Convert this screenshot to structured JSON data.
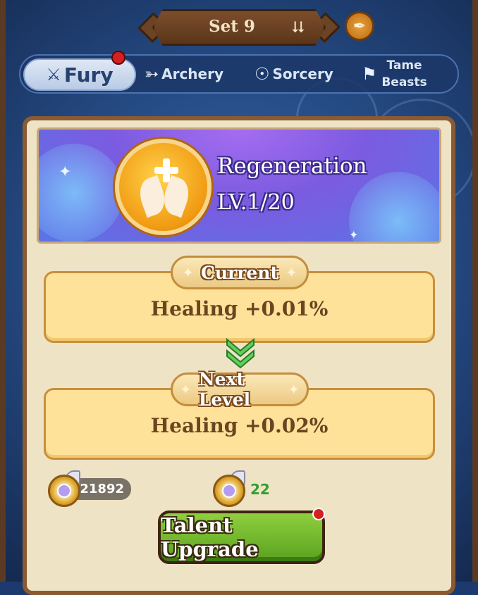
{
  "set_selector": {
    "label": "Set 9",
    "icon": "chevron-down-icon"
  },
  "feather_button": {
    "icon": "feather-icon"
  },
  "tabs": [
    {
      "label": "Fury",
      "icon": "sword-icon",
      "active": true,
      "notification": true
    },
    {
      "label": "Archery",
      "icon": "bow-icon",
      "active": false
    },
    {
      "label": "Sorcery",
      "icon": "magnifier-rune-icon",
      "active": false
    },
    {
      "label": "Tame Beasts",
      "icon": "beast-icon",
      "active": false
    }
  ],
  "skill": {
    "name": "Regeneration",
    "level": "LV.1/20",
    "icon": "leaf-plus-icon"
  },
  "current": {
    "title": "Current",
    "value": "Healing +0.01%"
  },
  "next": {
    "title": "Next Level",
    "value": "Healing +0.02%"
  },
  "currency": {
    "balance": "21892",
    "cost": "22",
    "cost_color": "#2ea02e"
  },
  "upgrade_button": {
    "label": "Talent Upgrade",
    "notification": true
  },
  "colors": {
    "accent_green": "#5aa21e",
    "panel_bg": "#efe3c6",
    "box_bg": "#ffe29a",
    "banner_purple": "#7b5be0"
  }
}
